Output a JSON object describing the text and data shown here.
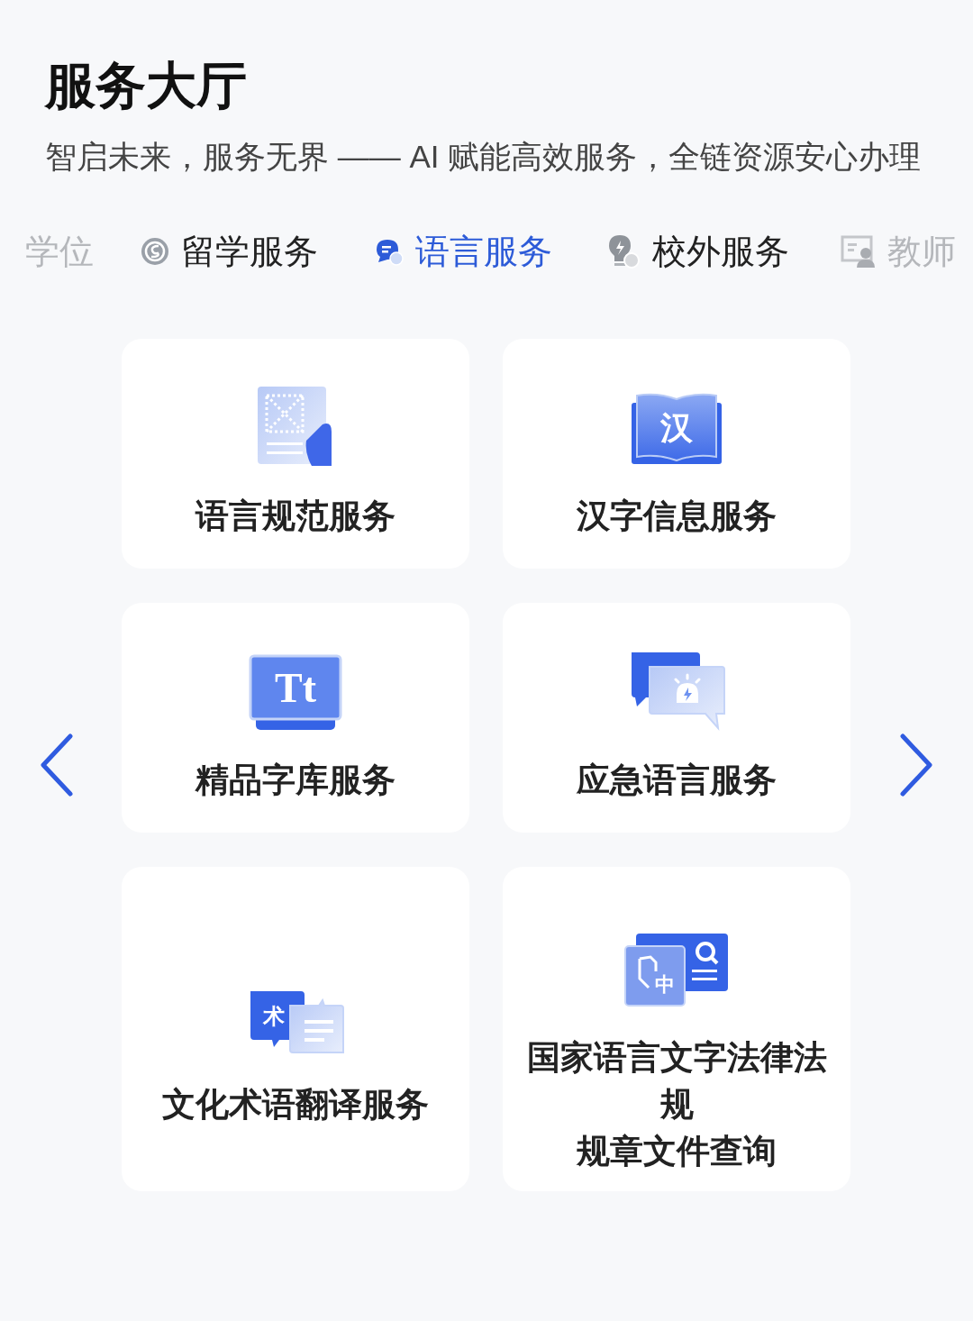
{
  "title": "服务大厅",
  "subtitle": "智启未来，服务无界 —— AI 赋能高效服务，全链资源安心办理",
  "tabs": [
    {
      "label": "学位",
      "selected": false
    },
    {
      "label": "留学服务",
      "kind": "globe",
      "selected": false
    },
    {
      "label": "语言服务",
      "kind": "chat",
      "selected": true
    },
    {
      "label": "校外服务",
      "kind": "bulb",
      "selected": false
    },
    {
      "label": "教师",
      "kind": "person",
      "selected": false
    }
  ],
  "cards": [
    {
      "label": "语言规范服务",
      "kind": "document"
    },
    {
      "label": "汉字信息服务",
      "kind": "book",
      "glyph": "汉"
    },
    {
      "label": "精品字库服务",
      "kind": "font",
      "glyph": "Tt"
    },
    {
      "label": "应急语言服务",
      "kind": "alarm"
    },
    {
      "label": "文化术语翻译服务",
      "kind": "translate",
      "glyph": "术"
    },
    {
      "label_lines": [
        "国家语言文字法律法规",
        "规章文件查询"
      ],
      "kind": "law",
      "glyph": "中"
    }
  ]
}
